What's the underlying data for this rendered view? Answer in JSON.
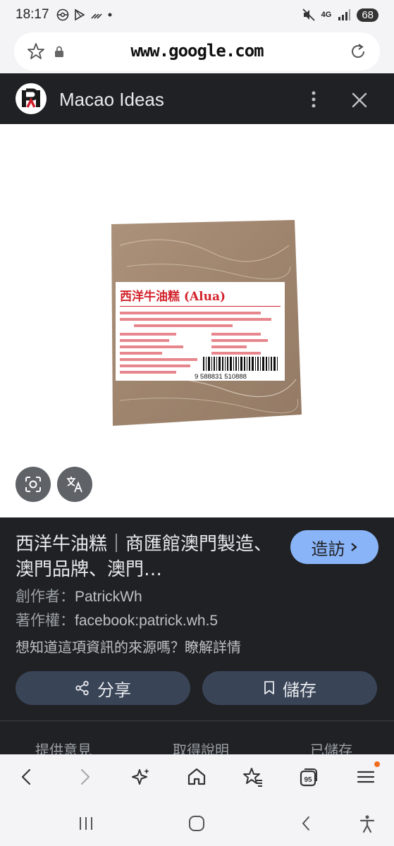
{
  "status_bar": {
    "time": "18:17",
    "network": "4G",
    "battery": "68"
  },
  "browser": {
    "url": "www.google.com"
  },
  "panel": {
    "site_name": "Macao Ideas"
  },
  "product_image": {
    "label_title": "西洋牛油糕 (Alua)",
    "barcode_number": "9 588831 510888"
  },
  "info": {
    "title": "西洋牛油糕｜商匯館澳門製造、澳門品牌、澳門…",
    "visit_label": "造訪",
    "creator_label": "創作者：",
    "creator_value": "PatrickWh",
    "copyright_label": "著作權：",
    "copyright_value": "facebook:patrick.wh.5",
    "source_text": "想知道這項資訊的來源嗎？瞭解詳情",
    "share_label": "分享",
    "save_label": "儲存",
    "bottom_links": [
      "提供意見",
      "取得說明",
      "已儲存"
    ]
  },
  "colors": {
    "panel_bg": "#202124",
    "accent_button": "#8ab4f8",
    "action_button": "#394457",
    "browser_chrome": "#f4f3f6",
    "notification_dot": "#f26b1d"
  },
  "icons": {
    "toolbar": [
      "back-icon",
      "forward-icon",
      "sparkle-icon",
      "home-icon",
      "bookmarks-star-icon",
      "tabs-icon",
      "menu-icon"
    ],
    "system_nav": [
      "recents-icon",
      "home-circle-icon",
      "system-back-icon",
      "accessibility-icon"
    ]
  }
}
